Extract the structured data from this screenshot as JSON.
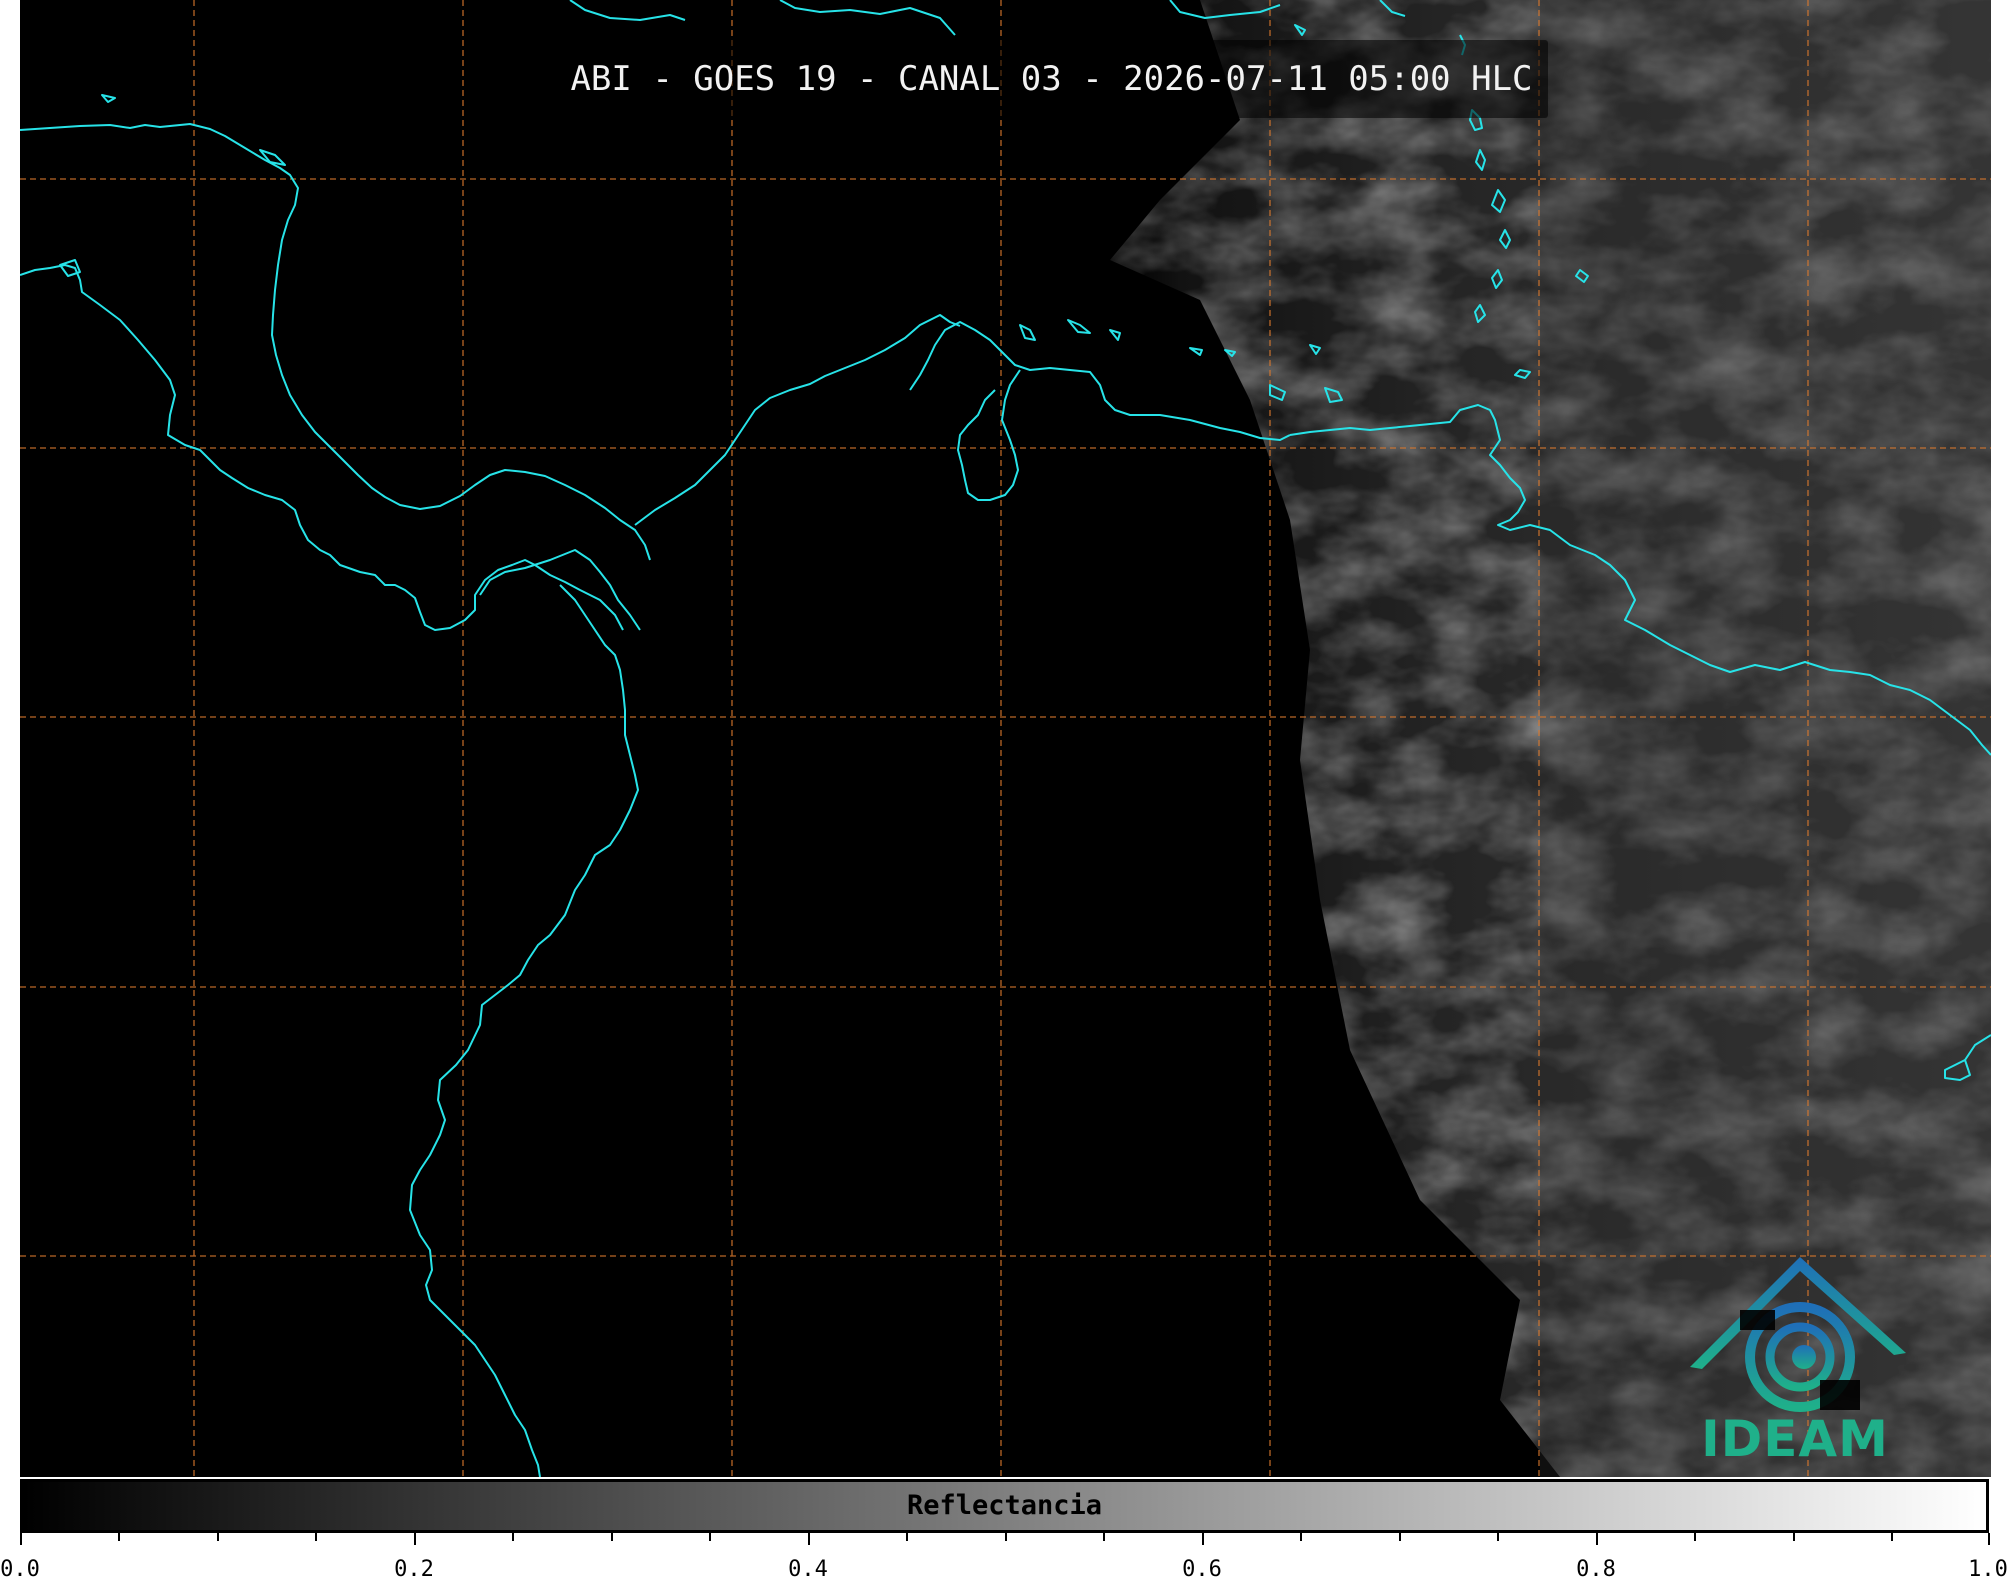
{
  "title": "ABI - GOES 19 - CANAL 03 - 2026-07-11 05:00 HLC",
  "colorbar": {
    "label": "Reflectancia",
    "ticks": [
      "0.0",
      "0.2",
      "0.4",
      "0.6",
      "0.8",
      "1.0"
    ],
    "range": [
      0.0,
      1.0
    ],
    "colormap": "grayscale black-to-white"
  },
  "logo": {
    "text": "IDEAM",
    "icon": "ideam-spiral-mountain-logo",
    "color": "#1fb08a"
  },
  "colors": {
    "coastline": "#27e3e8",
    "gridlines": "#d9782d",
    "background": "#000000"
  }
}
